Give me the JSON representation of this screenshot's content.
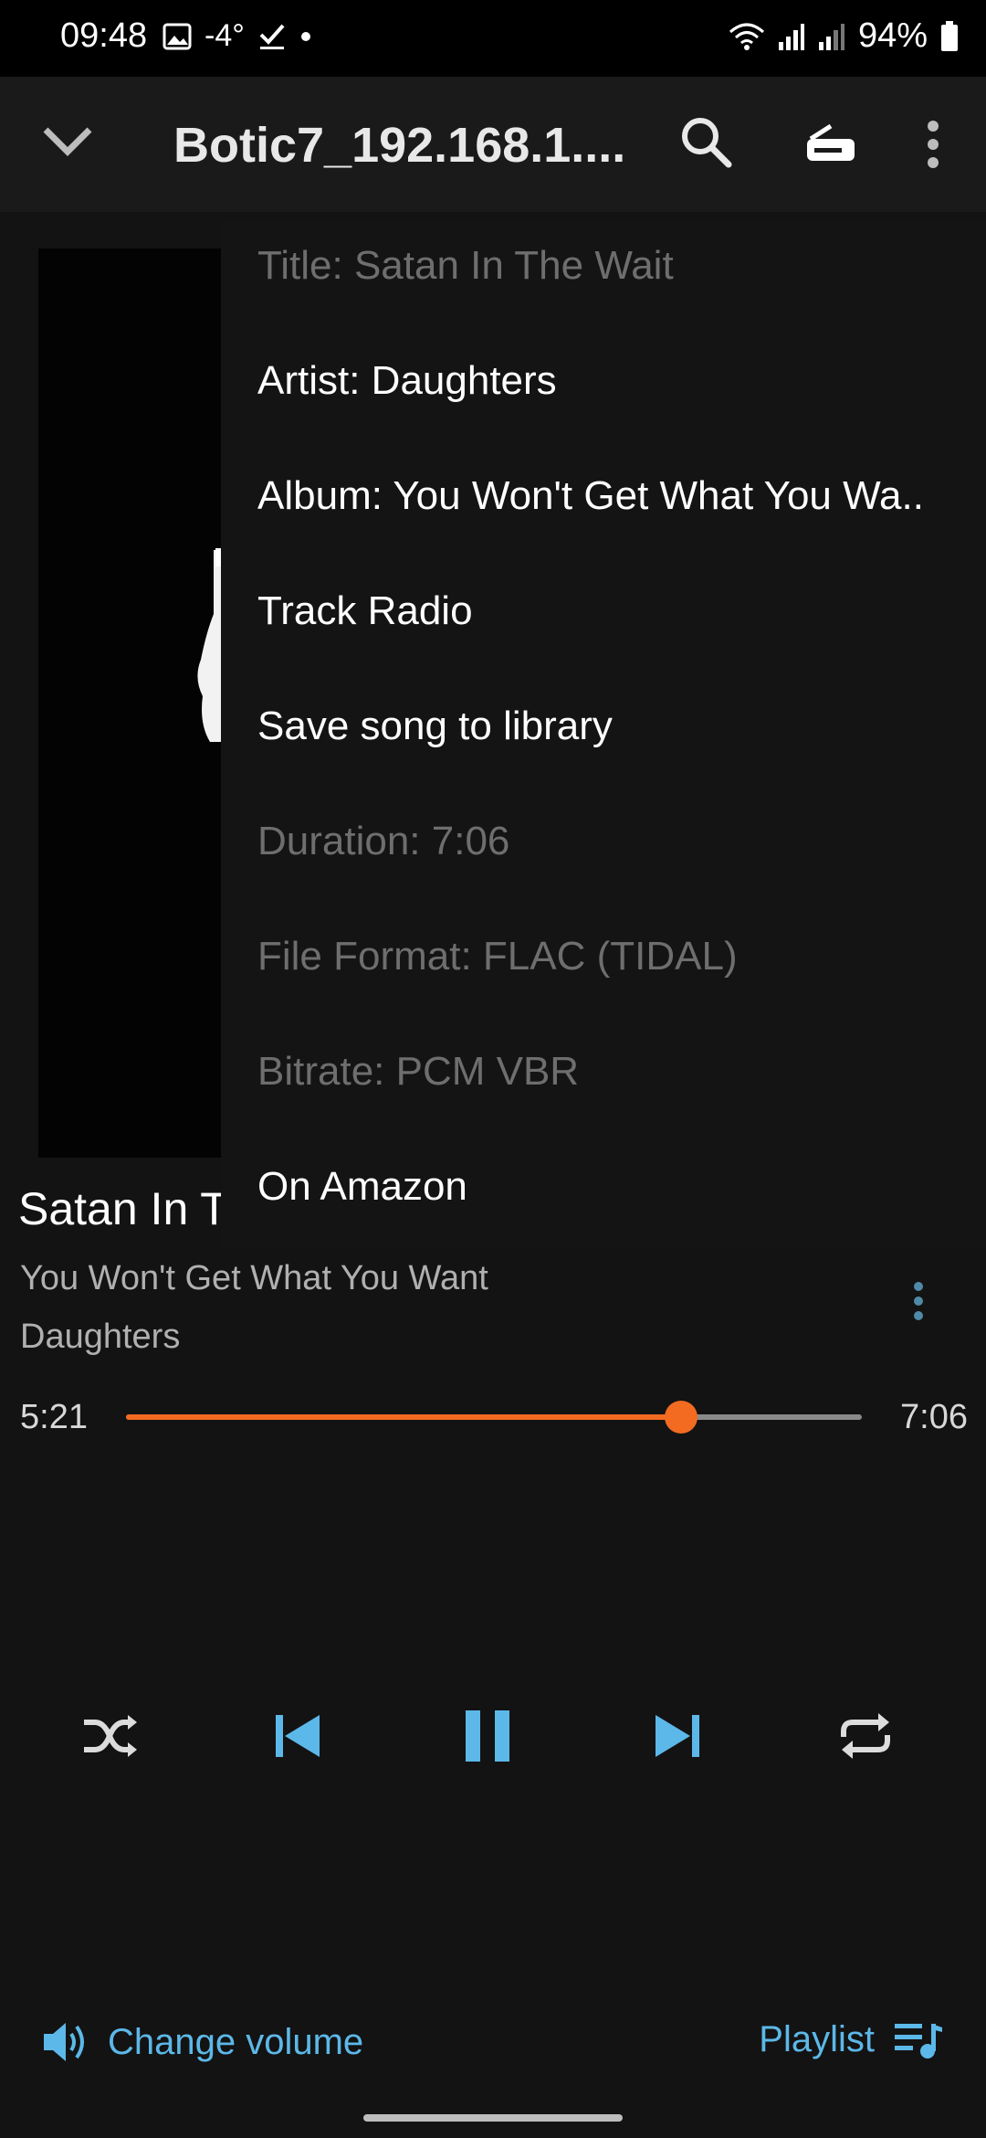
{
  "status_bar": {
    "time": "09:48",
    "temperature": "-4°",
    "battery": "94%",
    "icons": [
      "image-icon",
      "check-icon",
      "dot-icon",
      "wifi-icon",
      "signal-icon",
      "signal-icon-2",
      "battery-icon"
    ]
  },
  "toolbar": {
    "title": "Botic7_192.168.1....",
    "icons": [
      "chevron-down-icon",
      "search-icon",
      "device-icon",
      "more-vert-icon"
    ]
  },
  "menu": {
    "items": [
      {
        "label": "Title: Satan In The Wait",
        "enabled": false
      },
      {
        "label": "Artist: Daughters",
        "enabled": true
      },
      {
        "label": "Album: You Won't Get What You Wa..",
        "enabled": true
      },
      {
        "label": "Track Radio",
        "enabled": true
      },
      {
        "label": "Save song to library",
        "enabled": true
      },
      {
        "label": "Duration: 7:06",
        "enabled": false
      },
      {
        "label": "File Format: FLAC (TIDAL)",
        "enabled": false
      },
      {
        "label": "Bitrate: PCM VBR",
        "enabled": false
      },
      {
        "label": "On Amazon",
        "enabled": true
      }
    ]
  },
  "track": {
    "title": "Satan In T",
    "album": "You Won't Get What You Want",
    "artist": "Daughters"
  },
  "playback": {
    "current_time": "5:21",
    "total_time": "7:06",
    "progress": 0.754
  },
  "controls": [
    "shuffle-icon",
    "previous-icon",
    "pause-icon",
    "next-icon",
    "repeat-icon"
  ],
  "bottom": {
    "volume_label": "Change volume",
    "playlist_label": "Playlist"
  },
  "colors": {
    "accent": "#f26b21",
    "control": "#5cb8e8"
  }
}
